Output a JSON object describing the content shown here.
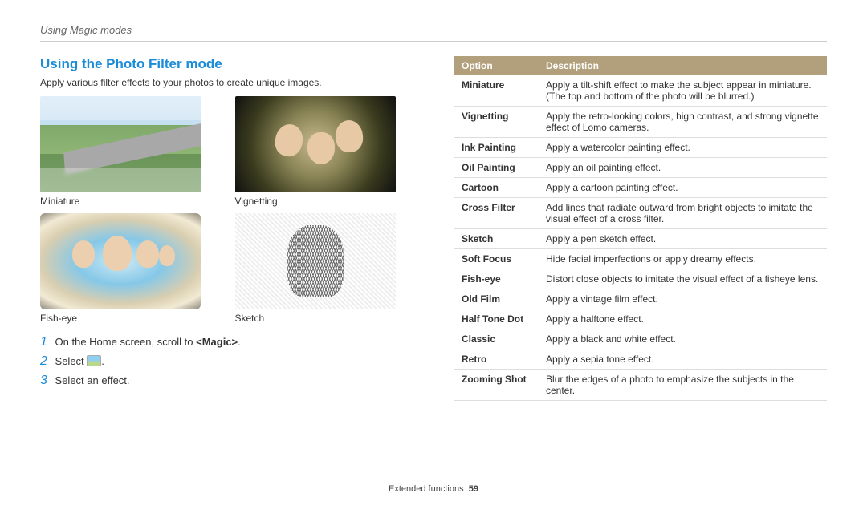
{
  "section_label": "Using Magic modes",
  "page_title": "Using the Photo Filter mode",
  "intro": "Apply various filter effects to your photos to create unique images.",
  "thumbs": [
    {
      "caption": "Miniature"
    },
    {
      "caption": "Vignetting"
    },
    {
      "caption": "Fish-eye"
    },
    {
      "caption": "Sketch"
    }
  ],
  "steps": [
    {
      "n": "1",
      "text_pre": "On the Home screen, scroll to ",
      "bold": "<Magic>",
      "text_post": "."
    },
    {
      "n": "2",
      "text_pre": "Select ",
      "icon": true,
      "text_post": "."
    },
    {
      "n": "3",
      "text_pre": "Select an effect.",
      "text_post": ""
    }
  ],
  "table": {
    "head_option": "Option",
    "head_desc": "Description",
    "rows": [
      {
        "opt": "Miniature",
        "desc": "Apply a tilt-shift effect to make the subject appear in miniature. (The top and bottom of the photo will be blurred.)"
      },
      {
        "opt": "Vignetting",
        "desc": "Apply the retro-looking colors, high contrast, and strong vignette effect of Lomo cameras."
      },
      {
        "opt": "Ink Painting",
        "desc": "Apply a watercolor painting effect."
      },
      {
        "opt": "Oil Painting",
        "desc": "Apply an oil painting effect."
      },
      {
        "opt": "Cartoon",
        "desc": "Apply a cartoon painting effect."
      },
      {
        "opt": "Cross Filter",
        "desc": "Add lines that radiate outward from bright objects to imitate the visual effect of a cross filter."
      },
      {
        "opt": "Sketch",
        "desc": "Apply a pen sketch effect."
      },
      {
        "opt": "Soft Focus",
        "desc": "Hide facial imperfections or apply dreamy effects."
      },
      {
        "opt": "Fish-eye",
        "desc": "Distort close objects to imitate the visual effect of a fisheye lens."
      },
      {
        "opt": "Old Film",
        "desc": "Apply a vintage film effect."
      },
      {
        "opt": "Half Tone Dot",
        "desc": "Apply a halftone effect."
      },
      {
        "opt": "Classic",
        "desc": "Apply a black and white effect."
      },
      {
        "opt": "Retro",
        "desc": "Apply a sepia tone effect."
      },
      {
        "opt": "Zooming Shot",
        "desc": "Blur the edges of a photo to emphasize the subjects in the center."
      }
    ]
  },
  "footer_label": "Extended functions",
  "page_number": "59"
}
